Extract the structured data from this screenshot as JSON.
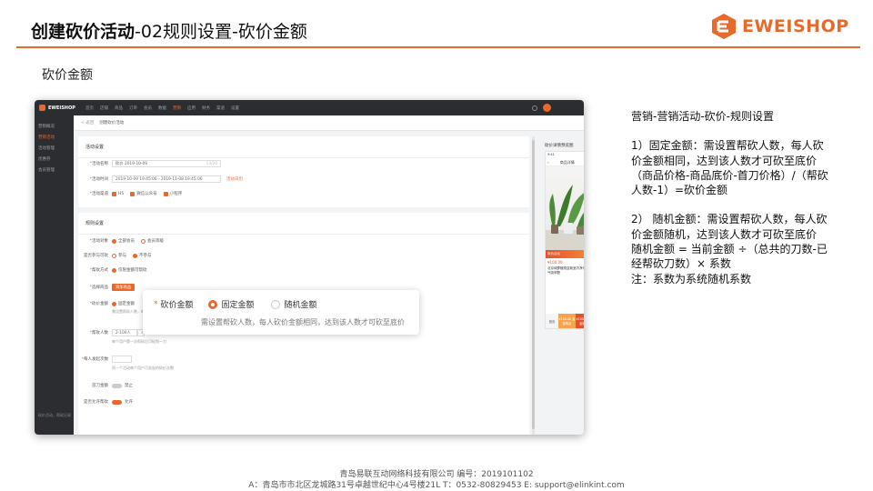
{
  "slide": {
    "title_bold": "创建砍价活动",
    "title_rest": "-02规则设置-砍价金额",
    "brand": "EWEISHOP",
    "accent": "#e8692a",
    "section_label": "砍价金额"
  },
  "app": {
    "logo": "EWEISHOP",
    "topnav": [
      "首页",
      "店铺",
      "商品",
      "订单",
      "会员",
      "数据",
      "营销",
      "应用",
      "财务",
      "渠道",
      "设置"
    ],
    "topnav_active": "营销",
    "sidebar": [
      "营销概况",
      "营销活动",
      "活动管理",
      "优惠券",
      "会员管理"
    ],
    "sidebar_active": "营销活动",
    "sidebar_footer": "砍价活动，帮砍记录",
    "crumb_back": "< 返回",
    "crumb_title": "创建砍价活动",
    "panel_heading": "活动设置",
    "fields": {
      "name_label": "活动名称",
      "name_value": "砍价 2019-10-09",
      "name_count": "13/20",
      "time_label": "活动时间",
      "time_value": "2019-10-09 19:45:06 - 2019-11-08 19:45:06",
      "time_link": "活动日历",
      "channel_label": "活动渠道",
      "channels": [
        "H5",
        "微信公众号",
        "小程序"
      ]
    },
    "rules_heading": "规则设置",
    "rules": {
      "users_label": "活动对象",
      "users_opts": [
        "全部会员",
        "会员等级"
      ],
      "repeat_label": "是否参与可砍",
      "repeat_opts": [
        "参与",
        "不参与"
      ],
      "type_label": "帮砍方式",
      "type_opts": [
        "仅限金额可帮砍"
      ],
      "goods_label": "选择商品",
      "goods_button": "添加商品",
      "price_label": "砍价金额",
      "price_opt": "固定金额",
      "price_hint": "需设置帮砍人数，每人砍价金额相同",
      "helpers_label": "帮砍人数",
      "helpers_value": "2-100人",
      "helpers_unit": "人",
      "helpers_hint": "每个用户第一次帮砍后可砍到一刀",
      "limit_label": "每人发起次数",
      "limit_hint": "同一个活动每个用户可发起的砍价次数",
      "toggle1_label": "首刀金额",
      "toggle1_text": "禁止",
      "toggle2_label": "是否允许帮砍",
      "toggle2_text": "允许"
    },
    "preview": {
      "title": "砍价详情预览图",
      "time": "9:41",
      "nav_title": "商品详情",
      "bar_text": "砍价活动",
      "price": "¥100.00",
      "name": "北京绿萝植物盆栽室内净化空气吸甲醛",
      "home": "首页",
      "buy_a": "¥100.00 直接购买",
      "buy_b": "¥100.00 发起砍价"
    }
  },
  "callout": {
    "label": "砍价金额",
    "options": [
      "固定金额",
      "随机金额"
    ],
    "selected": "固定金额",
    "hint": "需设置帮砍人数，每人砍价金额相同，达到该人数才可砍至底价"
  },
  "explain": {
    "heading": "营销-营销活动-砍价-规则设置",
    "p1": "1）固定金额：需设置帮砍人数，每人砍价金额相同，达到该人数才可砍至底价",
    "p2": "（商品价格-商品底价-首刀价格）/（帮砍人数-1）=砍价金额",
    "p3": "2）  随机金额：需设置帮砍人数，每人砍价金额随机，达到该人数才可砍至底价",
    "p4": "随机金额 = 当前金额 ÷（总共的刀数-已经帮砍刀数）× 系数",
    "p5": "注：系数为系统随机系数"
  },
  "footer": {
    "line1": "青岛易联互动网络科技有限公司    编号：2019101102",
    "line2": "A：青岛市市北区龙城路31号卓越世纪中心4号楼21L    T：0532-80829453    E: support@elinkint.com"
  }
}
